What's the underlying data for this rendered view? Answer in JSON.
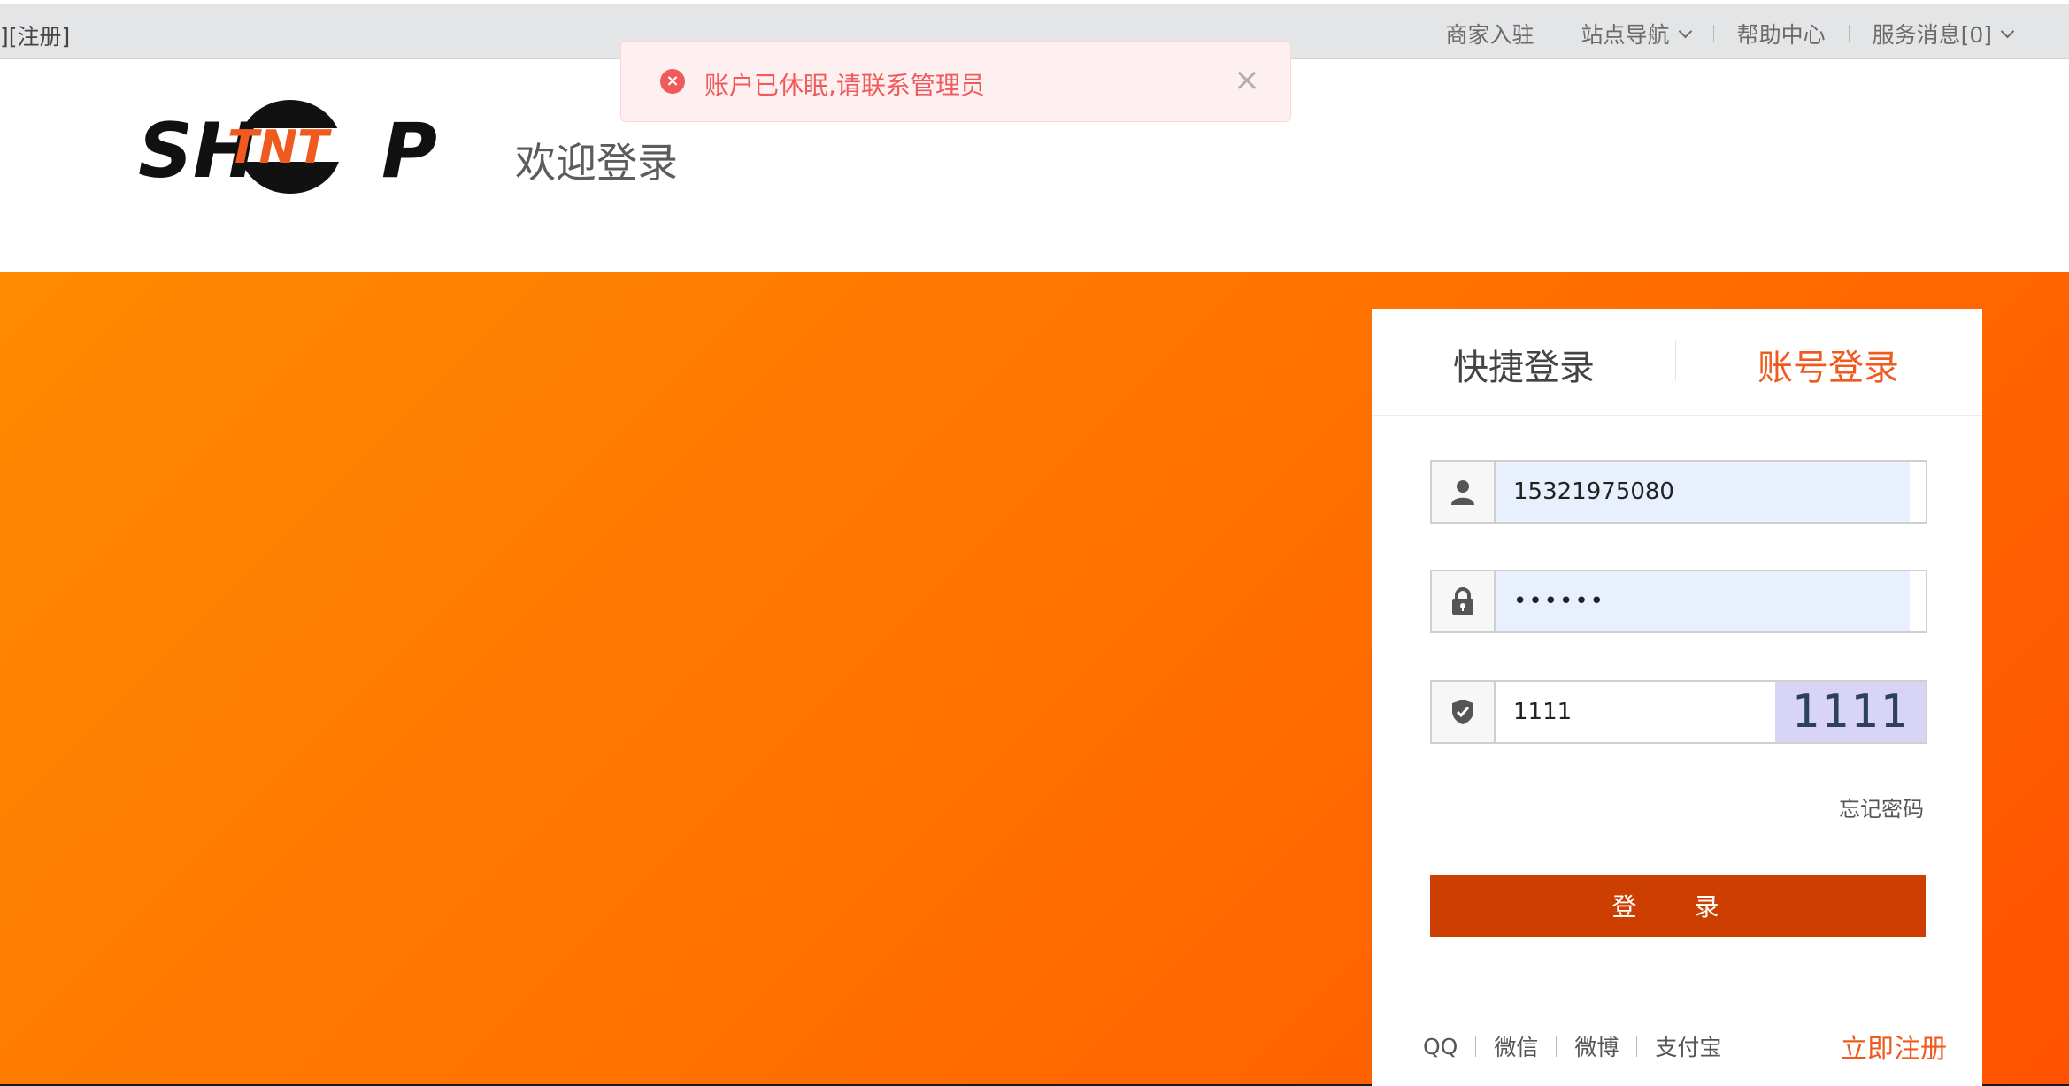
{
  "topbar": {
    "left_text": "][注册]",
    "links": [
      "商家入驻",
      "站点导航",
      "帮助中心",
      "服务消息[0]"
    ]
  },
  "toast": {
    "message": "账户已休眠,请联系管理员",
    "close_symbol": "×",
    "error_icon_symbol": "×"
  },
  "header": {
    "logo": {
      "left": "SH",
      "middle": "TNT",
      "right": "P"
    },
    "welcome": "欢迎登录"
  },
  "login": {
    "tabs": [
      "快捷登录",
      "账号登录"
    ],
    "active_tab": "账号登录",
    "username": "15321975080",
    "password_mask": "••••••",
    "captcha_input": "1111",
    "captcha_image_text": "1111",
    "forgot": "忘记密码",
    "submit": "登 录",
    "social": [
      "QQ",
      "微信",
      "微博",
      "支付宝"
    ],
    "register": "立即注册"
  },
  "colors": {
    "accent": "#f05a1e",
    "button": "#cc3f00",
    "banner_start": "#ff8a00",
    "banner_end": "#ff5200",
    "toast_text": "#f05a5a"
  }
}
